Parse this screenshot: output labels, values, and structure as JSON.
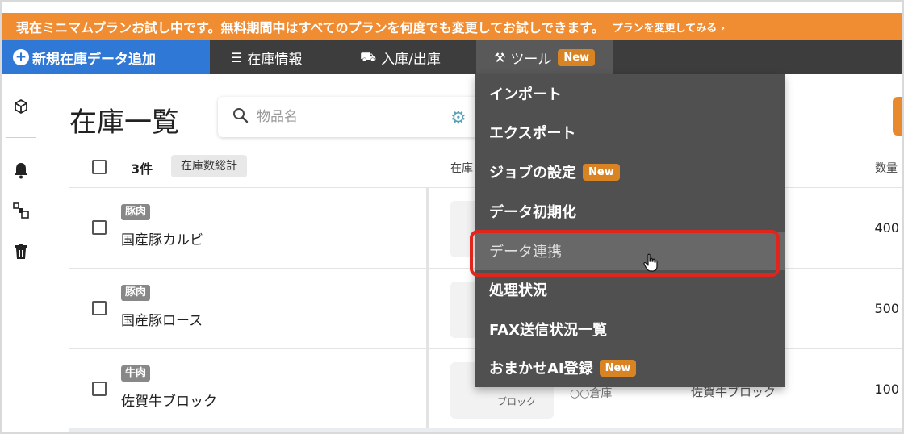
{
  "banner": {
    "message": "現在ミニマムプランお試し中です。無料期間中はすべてのプランを何度でも変更してお試しできます。",
    "link": "プランを変更してみる ›"
  },
  "navbar": {
    "add_label": "新規在庫データ追加",
    "inventory_info": "在庫情報",
    "in_out": "入庫/出庫",
    "tools": "ツール",
    "new_badge": "New"
  },
  "dropdown": {
    "items": [
      {
        "label": "インポート"
      },
      {
        "label": "エクスポート"
      },
      {
        "label": "ジョブの設定",
        "badge": "New"
      },
      {
        "label": "データ初期化"
      },
      {
        "label": "データ連携"
      },
      {
        "label": "処理状況"
      },
      {
        "label": "FAX送信状況一覧"
      },
      {
        "label": "おまかせAI登録",
        "badge": "New"
      }
    ]
  },
  "page": {
    "title": "在庫一覧",
    "search_placeholder": "物品名"
  },
  "table": {
    "count": "3件",
    "sum_button": "在庫数総計",
    "col_stock": "在庫",
    "col_qty": "数量",
    "rows": [
      {
        "tag": "豚肉",
        "name": "国産豚カルビ",
        "qty": "400"
      },
      {
        "tag": "豚肉",
        "name": "国産豚ロース",
        "qty": "500"
      },
      {
        "tag": "牛肉",
        "name": "佐賀牛ブロック",
        "qty": "100",
        "unit": "ブロック",
        "location": "○○倉庫",
        "name2": "佐賀牛ブロック"
      }
    ]
  },
  "colors": {
    "banner": "#f08c32",
    "navbar": "#3d3d3d",
    "add_button": "#2f78d6",
    "dropdown": "#505050",
    "highlight": "#e0261c"
  }
}
